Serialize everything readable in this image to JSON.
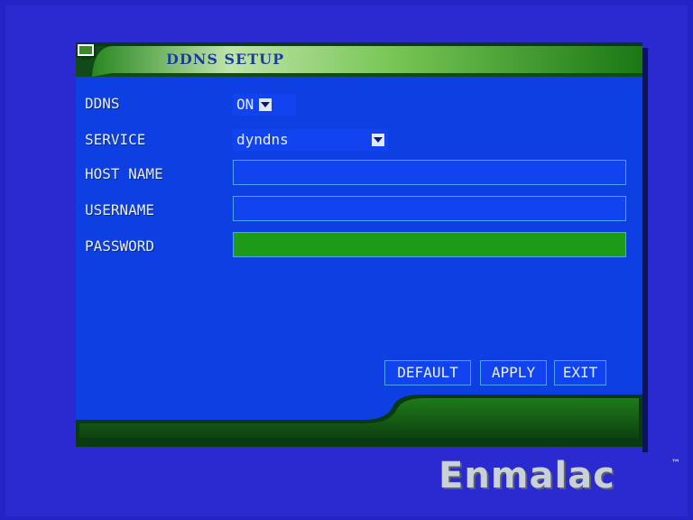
{
  "dialog": {
    "title": "DDNS SETUP",
    "title_icon": "monitor-icon"
  },
  "fields": {
    "ddns": {
      "label": "DDNS",
      "value": "ON"
    },
    "service": {
      "label": "SERVICE",
      "value": "dyndns"
    },
    "host_name": {
      "label": "HOST NAME",
      "value": ""
    },
    "username": {
      "label": "USERNAME",
      "value": ""
    },
    "password": {
      "label": "PASSWORD",
      "value": ""
    }
  },
  "buttons": {
    "default": "DEFAULT",
    "apply": "APPLY",
    "exit": "EXIT"
  },
  "branding": {
    "name": "Enmalac",
    "tm": "™"
  },
  "colors": {
    "background": "#2424c6",
    "panel": "#0d3fe2",
    "accent_green": "#1c9a18",
    "field_border": "#4ba4ff"
  }
}
